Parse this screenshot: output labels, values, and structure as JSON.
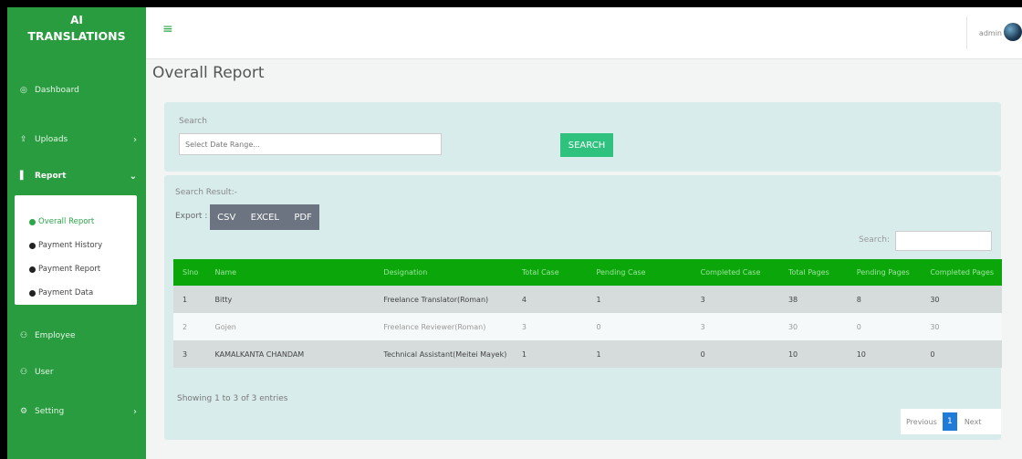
{
  "brand": {
    "line1": "AI",
    "line2": "TRANSLATIONS"
  },
  "sidebar": {
    "items": [
      {
        "icon": "dashboard-icon",
        "label": "Dashboard"
      },
      {
        "icon": "upload-icon",
        "label": "Uploads"
      },
      {
        "icon": "report-icon",
        "label": "Report"
      },
      {
        "icon": "employee-icon",
        "label": "Employee"
      },
      {
        "icon": "user-icon",
        "label": "User"
      },
      {
        "icon": "setting-icon",
        "label": "Setting"
      }
    ],
    "report_sub": [
      {
        "label": "Overall Report",
        "active": true
      },
      {
        "label": "Payment History",
        "active": false
      },
      {
        "label": "Payment Report",
        "active": false
      },
      {
        "label": "Payment Data",
        "active": false
      }
    ]
  },
  "topbar": {
    "user": "admin"
  },
  "page": {
    "title": "Overall Report"
  },
  "search": {
    "label": "Search",
    "placeholder": "Select Date Range...",
    "button": "SEARCH"
  },
  "result": {
    "label": "Search Result:-",
    "export_label": "Export :",
    "export_buttons": [
      "CSV",
      "EXCEL",
      "PDF"
    ],
    "table_search_label": "Search:",
    "columns": [
      "Slno",
      "Name",
      "Designation",
      "Total Case",
      "Pending Case",
      "Completed Case",
      "Total Pages",
      "Pending Pages",
      "Completed Pages"
    ],
    "rows": [
      [
        "1",
        "Bitty",
        "Freelance Translator(Roman)",
        "4",
        "1",
        "3",
        "38",
        "8",
        "30"
      ],
      [
        "2",
        "Gojen",
        "Freelance Reviewer(Roman)",
        "3",
        "0",
        "3",
        "30",
        "0",
        "30"
      ],
      [
        "3",
        "KAMALKANTA CHANDAM",
        "Technical Assistant(Meitei Mayek)",
        "1",
        "1",
        "0",
        "10",
        "10",
        "0"
      ]
    ],
    "showing": "Showing 1 to 3 of 3 entries",
    "pager": {
      "prev": "Previous",
      "current": "1",
      "next": "Next"
    }
  },
  "colors": {
    "sidebar": "#289c3f",
    "header_row": "#0aa60a",
    "search_button": "#2ec27e",
    "pager_active": "#1e7bd8"
  }
}
